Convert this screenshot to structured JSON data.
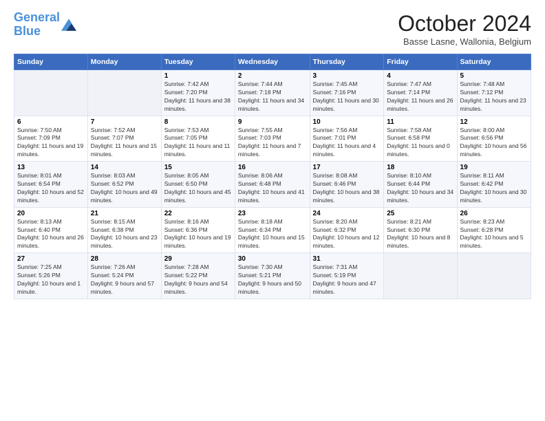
{
  "header": {
    "logo_line1": "General",
    "logo_line2": "Blue",
    "month": "October 2024",
    "location": "Basse Lasne, Wallonia, Belgium"
  },
  "days_of_week": [
    "Sunday",
    "Monday",
    "Tuesday",
    "Wednesday",
    "Thursday",
    "Friday",
    "Saturday"
  ],
  "weeks": [
    [
      {
        "num": "",
        "sunrise": "",
        "sunset": "",
        "daylight": ""
      },
      {
        "num": "",
        "sunrise": "",
        "sunset": "",
        "daylight": ""
      },
      {
        "num": "1",
        "sunrise": "Sunrise: 7:42 AM",
        "sunset": "Sunset: 7:20 PM",
        "daylight": "Daylight: 11 hours and 38 minutes."
      },
      {
        "num": "2",
        "sunrise": "Sunrise: 7:44 AM",
        "sunset": "Sunset: 7:18 PM",
        "daylight": "Daylight: 11 hours and 34 minutes."
      },
      {
        "num": "3",
        "sunrise": "Sunrise: 7:45 AM",
        "sunset": "Sunset: 7:16 PM",
        "daylight": "Daylight: 11 hours and 30 minutes."
      },
      {
        "num": "4",
        "sunrise": "Sunrise: 7:47 AM",
        "sunset": "Sunset: 7:14 PM",
        "daylight": "Daylight: 11 hours and 26 minutes."
      },
      {
        "num": "5",
        "sunrise": "Sunrise: 7:48 AM",
        "sunset": "Sunset: 7:12 PM",
        "daylight": "Daylight: 11 hours and 23 minutes."
      }
    ],
    [
      {
        "num": "6",
        "sunrise": "Sunrise: 7:50 AM",
        "sunset": "Sunset: 7:09 PM",
        "daylight": "Daylight: 11 hours and 19 minutes."
      },
      {
        "num": "7",
        "sunrise": "Sunrise: 7:52 AM",
        "sunset": "Sunset: 7:07 PM",
        "daylight": "Daylight: 11 hours and 15 minutes."
      },
      {
        "num": "8",
        "sunrise": "Sunrise: 7:53 AM",
        "sunset": "Sunset: 7:05 PM",
        "daylight": "Daylight: 11 hours and 11 minutes."
      },
      {
        "num": "9",
        "sunrise": "Sunrise: 7:55 AM",
        "sunset": "Sunset: 7:03 PM",
        "daylight": "Daylight: 11 hours and 7 minutes."
      },
      {
        "num": "10",
        "sunrise": "Sunrise: 7:56 AM",
        "sunset": "Sunset: 7:01 PM",
        "daylight": "Daylight: 11 hours and 4 minutes."
      },
      {
        "num": "11",
        "sunrise": "Sunrise: 7:58 AM",
        "sunset": "Sunset: 6:58 PM",
        "daylight": "Daylight: 11 hours and 0 minutes."
      },
      {
        "num": "12",
        "sunrise": "Sunrise: 8:00 AM",
        "sunset": "Sunset: 6:56 PM",
        "daylight": "Daylight: 10 hours and 56 minutes."
      }
    ],
    [
      {
        "num": "13",
        "sunrise": "Sunrise: 8:01 AM",
        "sunset": "Sunset: 6:54 PM",
        "daylight": "Daylight: 10 hours and 52 minutes."
      },
      {
        "num": "14",
        "sunrise": "Sunrise: 8:03 AM",
        "sunset": "Sunset: 6:52 PM",
        "daylight": "Daylight: 10 hours and 49 minutes."
      },
      {
        "num": "15",
        "sunrise": "Sunrise: 8:05 AM",
        "sunset": "Sunset: 6:50 PM",
        "daylight": "Daylight: 10 hours and 45 minutes."
      },
      {
        "num": "16",
        "sunrise": "Sunrise: 8:06 AM",
        "sunset": "Sunset: 6:48 PM",
        "daylight": "Daylight: 10 hours and 41 minutes."
      },
      {
        "num": "17",
        "sunrise": "Sunrise: 8:08 AM",
        "sunset": "Sunset: 6:46 PM",
        "daylight": "Daylight: 10 hours and 38 minutes."
      },
      {
        "num": "18",
        "sunrise": "Sunrise: 8:10 AM",
        "sunset": "Sunset: 6:44 PM",
        "daylight": "Daylight: 10 hours and 34 minutes."
      },
      {
        "num": "19",
        "sunrise": "Sunrise: 8:11 AM",
        "sunset": "Sunset: 6:42 PM",
        "daylight": "Daylight: 10 hours and 30 minutes."
      }
    ],
    [
      {
        "num": "20",
        "sunrise": "Sunrise: 8:13 AM",
        "sunset": "Sunset: 6:40 PM",
        "daylight": "Daylight: 10 hours and 26 minutes."
      },
      {
        "num": "21",
        "sunrise": "Sunrise: 8:15 AM",
        "sunset": "Sunset: 6:38 PM",
        "daylight": "Daylight: 10 hours and 23 minutes."
      },
      {
        "num": "22",
        "sunrise": "Sunrise: 8:16 AM",
        "sunset": "Sunset: 6:36 PM",
        "daylight": "Daylight: 10 hours and 19 minutes."
      },
      {
        "num": "23",
        "sunrise": "Sunrise: 8:18 AM",
        "sunset": "Sunset: 6:34 PM",
        "daylight": "Daylight: 10 hours and 15 minutes."
      },
      {
        "num": "24",
        "sunrise": "Sunrise: 8:20 AM",
        "sunset": "Sunset: 6:32 PM",
        "daylight": "Daylight: 10 hours and 12 minutes."
      },
      {
        "num": "25",
        "sunrise": "Sunrise: 8:21 AM",
        "sunset": "Sunset: 6:30 PM",
        "daylight": "Daylight: 10 hours and 8 minutes."
      },
      {
        "num": "26",
        "sunrise": "Sunrise: 8:23 AM",
        "sunset": "Sunset: 6:28 PM",
        "daylight": "Daylight: 10 hours and 5 minutes."
      }
    ],
    [
      {
        "num": "27",
        "sunrise": "Sunrise: 7:25 AM",
        "sunset": "Sunset: 5:26 PM",
        "daylight": "Daylight: 10 hours and 1 minute."
      },
      {
        "num": "28",
        "sunrise": "Sunrise: 7:26 AM",
        "sunset": "Sunset: 5:24 PM",
        "daylight": "Daylight: 9 hours and 57 minutes."
      },
      {
        "num": "29",
        "sunrise": "Sunrise: 7:28 AM",
        "sunset": "Sunset: 5:22 PM",
        "daylight": "Daylight: 9 hours and 54 minutes."
      },
      {
        "num": "30",
        "sunrise": "Sunrise: 7:30 AM",
        "sunset": "Sunset: 5:21 PM",
        "daylight": "Daylight: 9 hours and 50 minutes."
      },
      {
        "num": "31",
        "sunrise": "Sunrise: 7:31 AM",
        "sunset": "Sunset: 5:19 PM",
        "daylight": "Daylight: 9 hours and 47 minutes."
      },
      {
        "num": "",
        "sunrise": "",
        "sunset": "",
        "daylight": ""
      },
      {
        "num": "",
        "sunrise": "",
        "sunset": "",
        "daylight": ""
      }
    ]
  ]
}
